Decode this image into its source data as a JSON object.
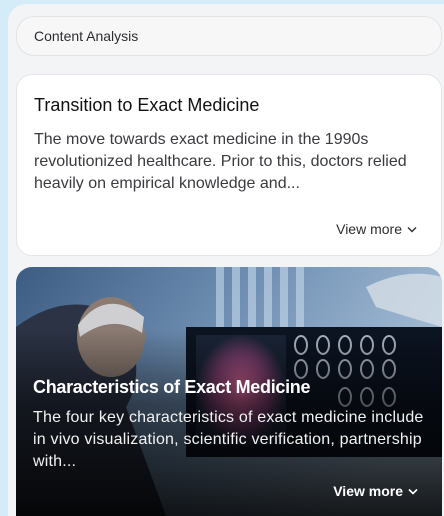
{
  "header": {
    "label": "Content Analysis"
  },
  "cards": [
    {
      "title": "Transition to Exact Medicine",
      "text": "The move towards exact medicine in the 1990s revolutionized healthcare. Prior to this, doctors relied heavily on empirical knowledge and...",
      "view_more": "View more"
    },
    {
      "title": "Characteristics of Exact Medicine",
      "text": "The four key characteristics of exact medicine include in vivo visualization, scientific verification, partnership with...",
      "view_more": "View more"
    }
  ],
  "colors": {
    "page_background": "#d4ecf8",
    "panel_background": "#f3f4f6",
    "card_background": "#ffffff"
  }
}
